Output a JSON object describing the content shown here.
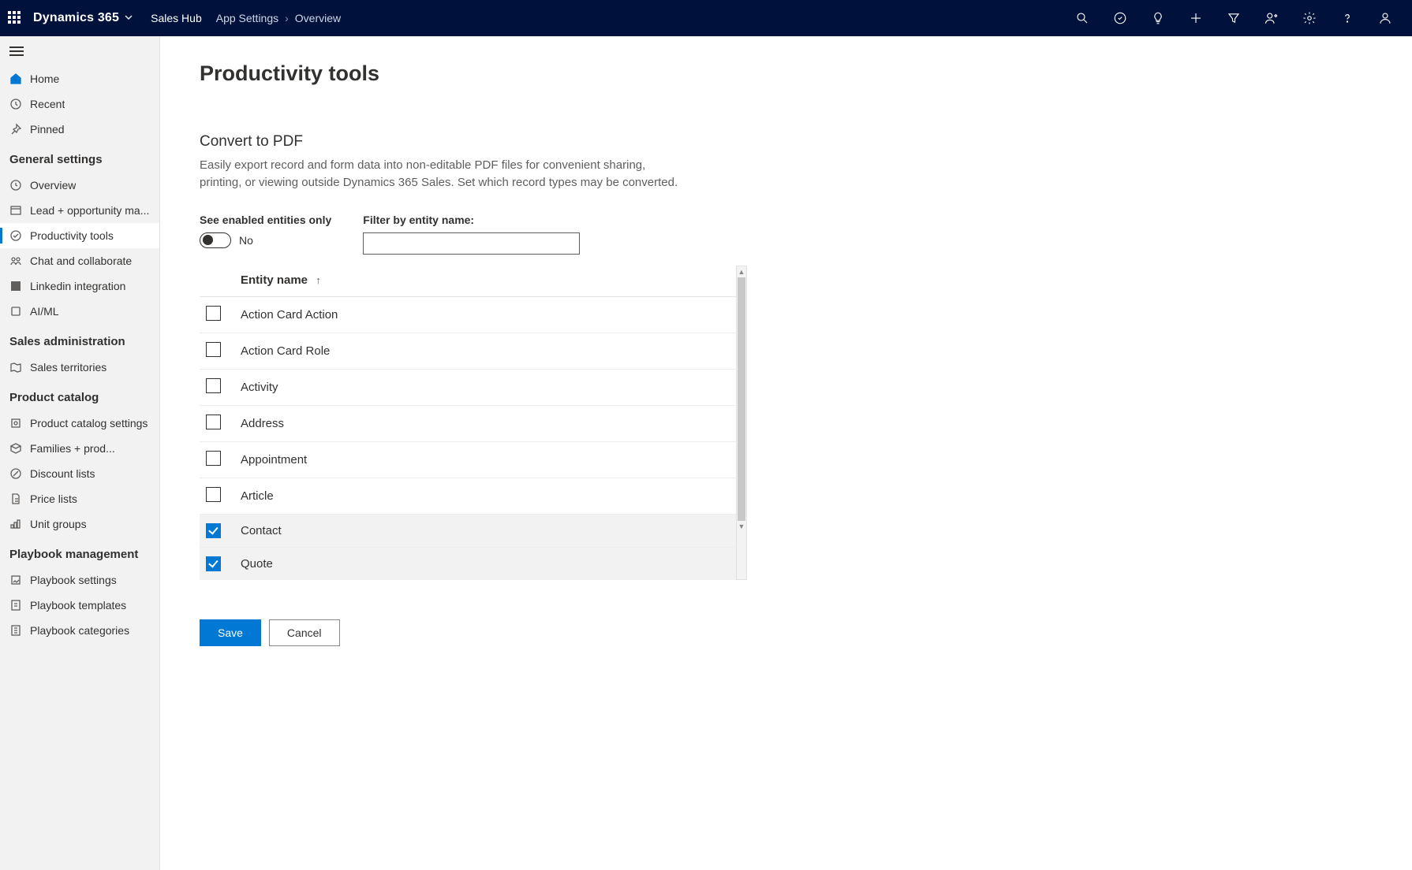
{
  "topbar": {
    "brand": "Dynamics 365",
    "app_name": "Sales Hub",
    "breadcrumb": [
      "App Settings",
      "Overview"
    ]
  },
  "sidebar": {
    "home": "Home",
    "recent": "Recent",
    "pinned": "Pinned",
    "groups": [
      {
        "title": "General settings",
        "items": [
          {
            "label": "Overview",
            "key": "overview"
          },
          {
            "label": "Lead + opportunity ma...",
            "key": "lead-opp"
          },
          {
            "label": "Productivity tools",
            "key": "productivity",
            "selected": true
          },
          {
            "label": "Chat and collaborate",
            "key": "chat"
          },
          {
            "label": "Linkedin integration",
            "key": "linkedin"
          },
          {
            "label": "AI/ML",
            "key": "aiml"
          }
        ]
      },
      {
        "title": "Sales administration",
        "items": [
          {
            "label": "Sales territories",
            "key": "territories"
          }
        ]
      },
      {
        "title": "Product catalog",
        "items": [
          {
            "label": "Product catalog settings",
            "key": "pc-settings"
          },
          {
            "label": "Families + prod...",
            "key": "families"
          },
          {
            "label": "Discount lists",
            "key": "discount"
          },
          {
            "label": "Price lists",
            "key": "price"
          },
          {
            "label": "Unit groups",
            "key": "unit"
          }
        ]
      },
      {
        "title": "Playbook management",
        "items": [
          {
            "label": "Playbook settings",
            "key": "pb-settings"
          },
          {
            "label": "Playbook templates",
            "key": "pb-templates"
          },
          {
            "label": "Playbook categories",
            "key": "pb-categories"
          }
        ]
      }
    ]
  },
  "page": {
    "title": "Productivity tools",
    "section_title": "Convert to PDF",
    "section_desc": "Easily export record and form data into non-editable PDF files for convenient sharing, printing, or viewing outside Dynamics 365 Sales. Set which record types may be converted.",
    "toggle_label": "See enabled entities only",
    "toggle_value": "No",
    "filter_label": "Filter by entity name:",
    "filter_value": "",
    "column_header": "Entity name",
    "entities": [
      {
        "name": "Action Card Action",
        "checked": false
      },
      {
        "name": "Action Card Role",
        "checked": false
      },
      {
        "name": "Activity",
        "checked": false
      },
      {
        "name": "Address",
        "checked": false
      },
      {
        "name": "Appointment",
        "checked": false
      },
      {
        "name": "Article",
        "checked": false
      },
      {
        "name": "Contact",
        "checked": true
      },
      {
        "name": "Quote",
        "checked": true
      }
    ],
    "save_label": "Save",
    "cancel_label": "Cancel"
  }
}
